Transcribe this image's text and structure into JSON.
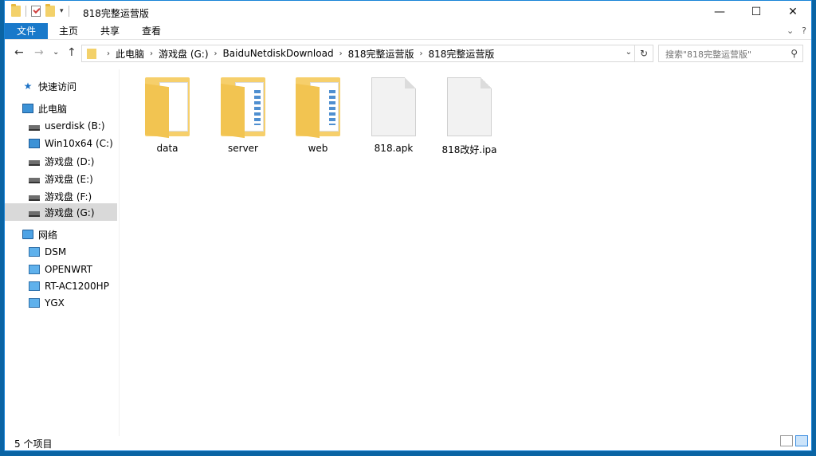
{
  "window": {
    "title": "818完整运营版"
  },
  "controls": {
    "minimize": "—",
    "maximize": "☐",
    "close": "✕"
  },
  "menu": {
    "file": "文件",
    "home": "主页",
    "share": "共享",
    "view": "查看",
    "expand": "⌄",
    "help": "?"
  },
  "nav": {
    "back": "←",
    "forward": "→",
    "recent": "⌄",
    "up": "↑"
  },
  "address": {
    "crumbs": [
      "此电脑",
      "游戏盘 (G:)",
      "BaiduNetdiskDownload",
      "818完整运营版",
      "818完整运营版"
    ],
    "separator": "›",
    "dropdown": "⌄",
    "refresh": "↻"
  },
  "search": {
    "placeholder": "搜索\"818完整运营版\"",
    "icon": "search-icon"
  },
  "sidebar": {
    "quick_access": "快速访问",
    "this_pc": "此电脑",
    "drives": [
      "userdisk (B:)",
      "Win10x64 (C:)",
      "游戏盘 (D:)",
      "游戏盘 (E:)",
      "游戏盘 (F:)",
      "游戏盘 (G:)"
    ],
    "selected_drive": "游戏盘 (G:)",
    "network": "网络",
    "network_items": [
      "DSM",
      "OPENWRT",
      "RT-AC1200HP",
      "YGX"
    ]
  },
  "files": [
    {
      "name": "data",
      "type": "folder"
    },
    {
      "name": "server",
      "type": "folder"
    },
    {
      "name": "web",
      "type": "folder"
    },
    {
      "name": "818.apk",
      "type": "file"
    },
    {
      "name": "818改好.ipa",
      "type": "file"
    }
  ],
  "status": {
    "count": "5 个项目"
  },
  "colors": {
    "accent": "#1979ca",
    "folder": "#f6cf6b",
    "selection": "#d9d9d9"
  }
}
